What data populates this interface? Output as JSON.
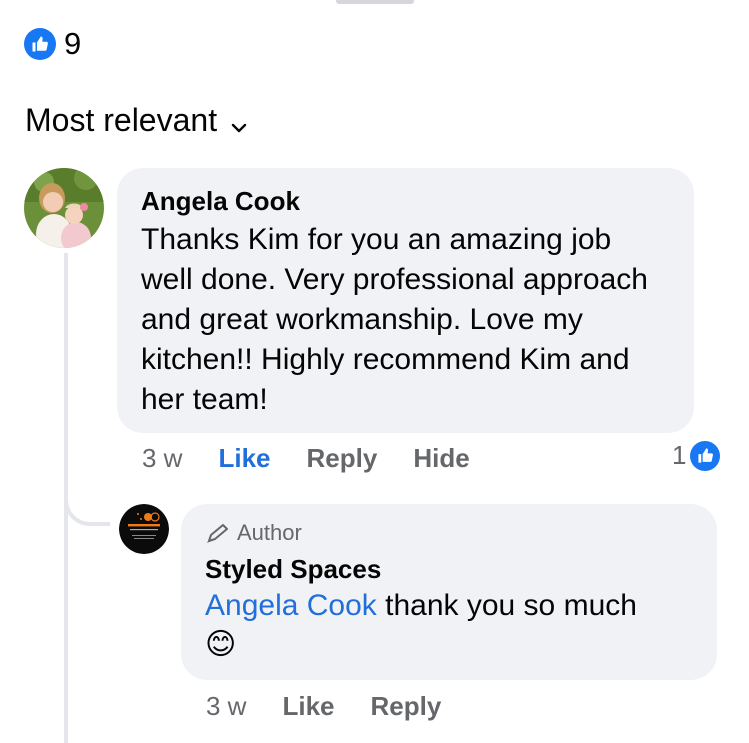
{
  "post": {
    "reaction_count": "9"
  },
  "sort": {
    "label": "Most relevant"
  },
  "comments": [
    {
      "author": "Angela Cook",
      "text": "Thanks Kim for you an amazing job well done.   Very professional approach and great workmanship. Love my kitchen!!   Highly recommend Kim and her team!",
      "time": "3 w",
      "actions": {
        "like": "Like",
        "reply": "Reply",
        "hide": "Hide"
      },
      "reaction_count": "1",
      "replies": [
        {
          "badge": "Author",
          "author": "Styled Spaces",
          "mention": "Angela Cook",
          "text": " thank you so much",
          "emoji": "😊",
          "time": "3 w",
          "actions": {
            "like": "Like",
            "reply": "Reply"
          }
        }
      ]
    }
  ],
  "colors": {
    "accent": "#1877f2",
    "link": "#216fdb",
    "bubble": "#f0f2f5",
    "muted_text": "#65676b"
  },
  "icons": {
    "reaction": "thumbs-up-icon",
    "sort": "chevron-down-icon",
    "author_badge": "pencil-icon"
  }
}
